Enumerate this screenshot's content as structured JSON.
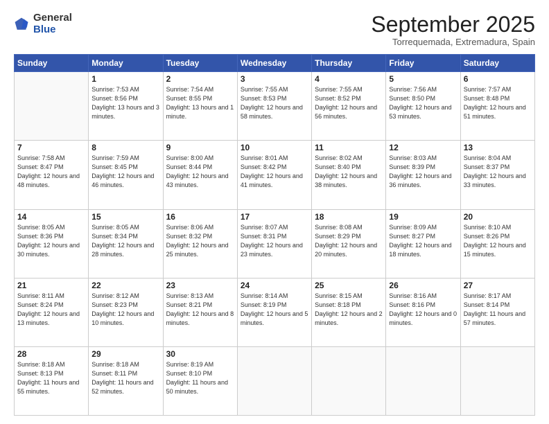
{
  "logo": {
    "general": "General",
    "blue": "Blue"
  },
  "title": {
    "month": "September 2025",
    "location": "Torrequemada, Extremadura, Spain"
  },
  "weekdays": [
    "Sunday",
    "Monday",
    "Tuesday",
    "Wednesday",
    "Thursday",
    "Friday",
    "Saturday"
  ],
  "weeks": [
    [
      {
        "day": "",
        "sunrise": "",
        "sunset": "",
        "daylight": ""
      },
      {
        "day": "1",
        "sunrise": "Sunrise: 7:53 AM",
        "sunset": "Sunset: 8:56 PM",
        "daylight": "Daylight: 13 hours and 3 minutes."
      },
      {
        "day": "2",
        "sunrise": "Sunrise: 7:54 AM",
        "sunset": "Sunset: 8:55 PM",
        "daylight": "Daylight: 13 hours and 1 minute."
      },
      {
        "day": "3",
        "sunrise": "Sunrise: 7:55 AM",
        "sunset": "Sunset: 8:53 PM",
        "daylight": "Daylight: 12 hours and 58 minutes."
      },
      {
        "day": "4",
        "sunrise": "Sunrise: 7:55 AM",
        "sunset": "Sunset: 8:52 PM",
        "daylight": "Daylight: 12 hours and 56 minutes."
      },
      {
        "day": "5",
        "sunrise": "Sunrise: 7:56 AM",
        "sunset": "Sunset: 8:50 PM",
        "daylight": "Daylight: 12 hours and 53 minutes."
      },
      {
        "day": "6",
        "sunrise": "Sunrise: 7:57 AM",
        "sunset": "Sunset: 8:48 PM",
        "daylight": "Daylight: 12 hours and 51 minutes."
      }
    ],
    [
      {
        "day": "7",
        "sunrise": "Sunrise: 7:58 AM",
        "sunset": "Sunset: 8:47 PM",
        "daylight": "Daylight: 12 hours and 48 minutes."
      },
      {
        "day": "8",
        "sunrise": "Sunrise: 7:59 AM",
        "sunset": "Sunset: 8:45 PM",
        "daylight": "Daylight: 12 hours and 46 minutes."
      },
      {
        "day": "9",
        "sunrise": "Sunrise: 8:00 AM",
        "sunset": "Sunset: 8:44 PM",
        "daylight": "Daylight: 12 hours and 43 minutes."
      },
      {
        "day": "10",
        "sunrise": "Sunrise: 8:01 AM",
        "sunset": "Sunset: 8:42 PM",
        "daylight": "Daylight: 12 hours and 41 minutes."
      },
      {
        "day": "11",
        "sunrise": "Sunrise: 8:02 AM",
        "sunset": "Sunset: 8:40 PM",
        "daylight": "Daylight: 12 hours and 38 minutes."
      },
      {
        "day": "12",
        "sunrise": "Sunrise: 8:03 AM",
        "sunset": "Sunset: 8:39 PM",
        "daylight": "Daylight: 12 hours and 36 minutes."
      },
      {
        "day": "13",
        "sunrise": "Sunrise: 8:04 AM",
        "sunset": "Sunset: 8:37 PM",
        "daylight": "Daylight: 12 hours and 33 minutes."
      }
    ],
    [
      {
        "day": "14",
        "sunrise": "Sunrise: 8:05 AM",
        "sunset": "Sunset: 8:36 PM",
        "daylight": "Daylight: 12 hours and 30 minutes."
      },
      {
        "day": "15",
        "sunrise": "Sunrise: 8:05 AM",
        "sunset": "Sunset: 8:34 PM",
        "daylight": "Daylight: 12 hours and 28 minutes."
      },
      {
        "day": "16",
        "sunrise": "Sunrise: 8:06 AM",
        "sunset": "Sunset: 8:32 PM",
        "daylight": "Daylight: 12 hours and 25 minutes."
      },
      {
        "day": "17",
        "sunrise": "Sunrise: 8:07 AM",
        "sunset": "Sunset: 8:31 PM",
        "daylight": "Daylight: 12 hours and 23 minutes."
      },
      {
        "day": "18",
        "sunrise": "Sunrise: 8:08 AM",
        "sunset": "Sunset: 8:29 PM",
        "daylight": "Daylight: 12 hours and 20 minutes."
      },
      {
        "day": "19",
        "sunrise": "Sunrise: 8:09 AM",
        "sunset": "Sunset: 8:27 PM",
        "daylight": "Daylight: 12 hours and 18 minutes."
      },
      {
        "day": "20",
        "sunrise": "Sunrise: 8:10 AM",
        "sunset": "Sunset: 8:26 PM",
        "daylight": "Daylight: 12 hours and 15 minutes."
      }
    ],
    [
      {
        "day": "21",
        "sunrise": "Sunrise: 8:11 AM",
        "sunset": "Sunset: 8:24 PM",
        "daylight": "Daylight: 12 hours and 13 minutes."
      },
      {
        "day": "22",
        "sunrise": "Sunrise: 8:12 AM",
        "sunset": "Sunset: 8:23 PM",
        "daylight": "Daylight: 12 hours and 10 minutes."
      },
      {
        "day": "23",
        "sunrise": "Sunrise: 8:13 AM",
        "sunset": "Sunset: 8:21 PM",
        "daylight": "Daylight: 12 hours and 8 minutes."
      },
      {
        "day": "24",
        "sunrise": "Sunrise: 8:14 AM",
        "sunset": "Sunset: 8:19 PM",
        "daylight": "Daylight: 12 hours and 5 minutes."
      },
      {
        "day": "25",
        "sunrise": "Sunrise: 8:15 AM",
        "sunset": "Sunset: 8:18 PM",
        "daylight": "Daylight: 12 hours and 2 minutes."
      },
      {
        "day": "26",
        "sunrise": "Sunrise: 8:16 AM",
        "sunset": "Sunset: 8:16 PM",
        "daylight": "Daylight: 12 hours and 0 minutes."
      },
      {
        "day": "27",
        "sunrise": "Sunrise: 8:17 AM",
        "sunset": "Sunset: 8:14 PM",
        "daylight": "Daylight: 11 hours and 57 minutes."
      }
    ],
    [
      {
        "day": "28",
        "sunrise": "Sunrise: 8:18 AM",
        "sunset": "Sunset: 8:13 PM",
        "daylight": "Daylight: 11 hours and 55 minutes."
      },
      {
        "day": "29",
        "sunrise": "Sunrise: 8:18 AM",
        "sunset": "Sunset: 8:11 PM",
        "daylight": "Daylight: 11 hours and 52 minutes."
      },
      {
        "day": "30",
        "sunrise": "Sunrise: 8:19 AM",
        "sunset": "Sunset: 8:10 PM",
        "daylight": "Daylight: 11 hours and 50 minutes."
      },
      {
        "day": "",
        "sunrise": "",
        "sunset": "",
        "daylight": ""
      },
      {
        "day": "",
        "sunrise": "",
        "sunset": "",
        "daylight": ""
      },
      {
        "day": "",
        "sunrise": "",
        "sunset": "",
        "daylight": ""
      },
      {
        "day": "",
        "sunrise": "",
        "sunset": "",
        "daylight": ""
      }
    ]
  ]
}
